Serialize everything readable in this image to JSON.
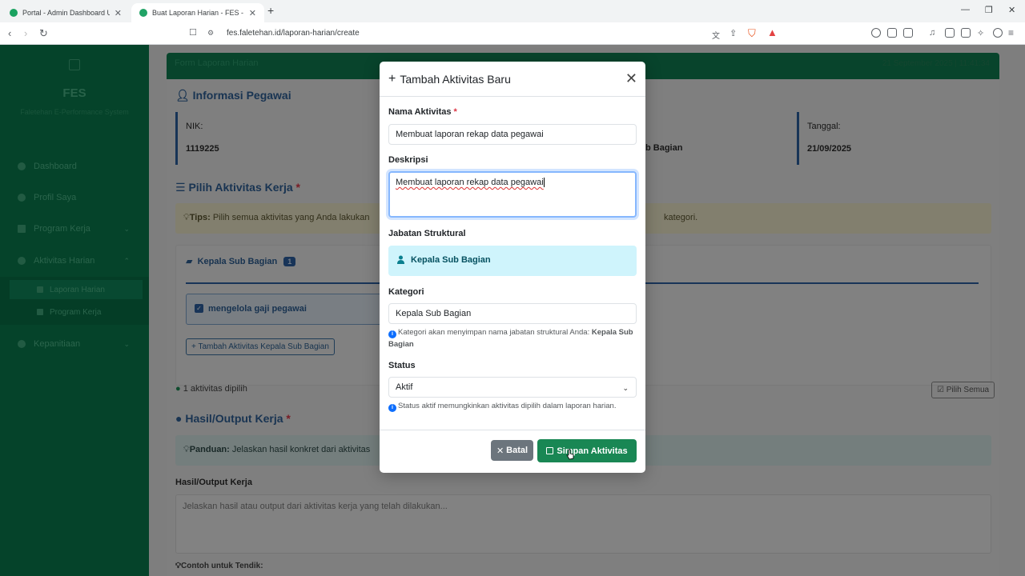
{
  "browser": {
    "tabs": [
      {
        "title": "Portal - Admin Dashboard Universita",
        "active": false
      },
      {
        "title": "Buat Laporan Harian - FES - Falet",
        "active": true
      }
    ],
    "url": "fes.faletehan.id/laporan-harian/create"
  },
  "sidebar": {
    "brand": "FES",
    "subtitle": "Faletehan E-Performance System",
    "items": [
      {
        "label": "Dashboard"
      },
      {
        "label": "Profil Saya"
      },
      {
        "label": "Program Kerja"
      },
      {
        "label": "Aktivitas Harian"
      },
      {
        "label": "Kepanitiaan"
      }
    ],
    "sub_items": [
      {
        "label": "Laporan Harian"
      },
      {
        "label": "Program Kerja"
      }
    ]
  },
  "page": {
    "header_title": "Form Laporan Harian",
    "header_datetime": "21 September 2025 | 11:41:34",
    "informasi_title": "Informasi Pegawai",
    "nik_label": "NIK:",
    "nik_value": "1119225",
    "jabatan_value_partial": "b Bagian",
    "tanggal_label": "Tanggal:",
    "tanggal_value": "21/09/2025",
    "pilih_title": "Pilih Aktivitas Kerja",
    "tips_label": "Tips:",
    "tips_text": "Pilih semua aktivitas yang Anda lakukan",
    "tips_tail": "kategori.",
    "group_label": "Kepala Sub Bagian",
    "group_count": "1",
    "activity": "mengelola gaji pegawai",
    "add_button": "+ Tambah Aktivitas Kepala Sub Bagian",
    "selected_count": "1 aktivitas dipilih",
    "select_all": "Pilih Semua",
    "hasil_title": "Hasil/Output Kerja",
    "panduan_label": "Panduan:",
    "panduan_text": "Jelaskan hasil konkret dari aktivitas",
    "hasil_label": "Hasil/Output Kerja",
    "hasil_placeholder": "Jelaskan hasil atau output dari aktivitas kerja yang telah dilakukan...",
    "contoh": "Contoh untuk Tendik:"
  },
  "modal": {
    "title": "Tambah Aktivitas Baru",
    "nama_label": "Nama Aktivitas",
    "nama_value": "Membuat laporan rekap data pegawai",
    "deskripsi_label": "Deskripsi",
    "deskripsi_value": "Membuat laporan rekap data pegawai",
    "jabatan_label": "Jabatan Struktural",
    "jabatan_value": "Kepala Sub Bagian",
    "kategori_label": "Kategori",
    "kategori_value": "Kepala Sub Bagian",
    "kategori_help": "Kategori akan menyimpan nama jabatan struktural Anda:",
    "kategori_help_bold": "Kepala Sub Bagian",
    "status_label": "Status",
    "status_value": "Aktif",
    "status_help": "Status aktif memungkinkan aktivitas dipilih dalam laporan harian.",
    "batal_label": "Batal",
    "simpan_label": "Simpan Aktivitas"
  }
}
